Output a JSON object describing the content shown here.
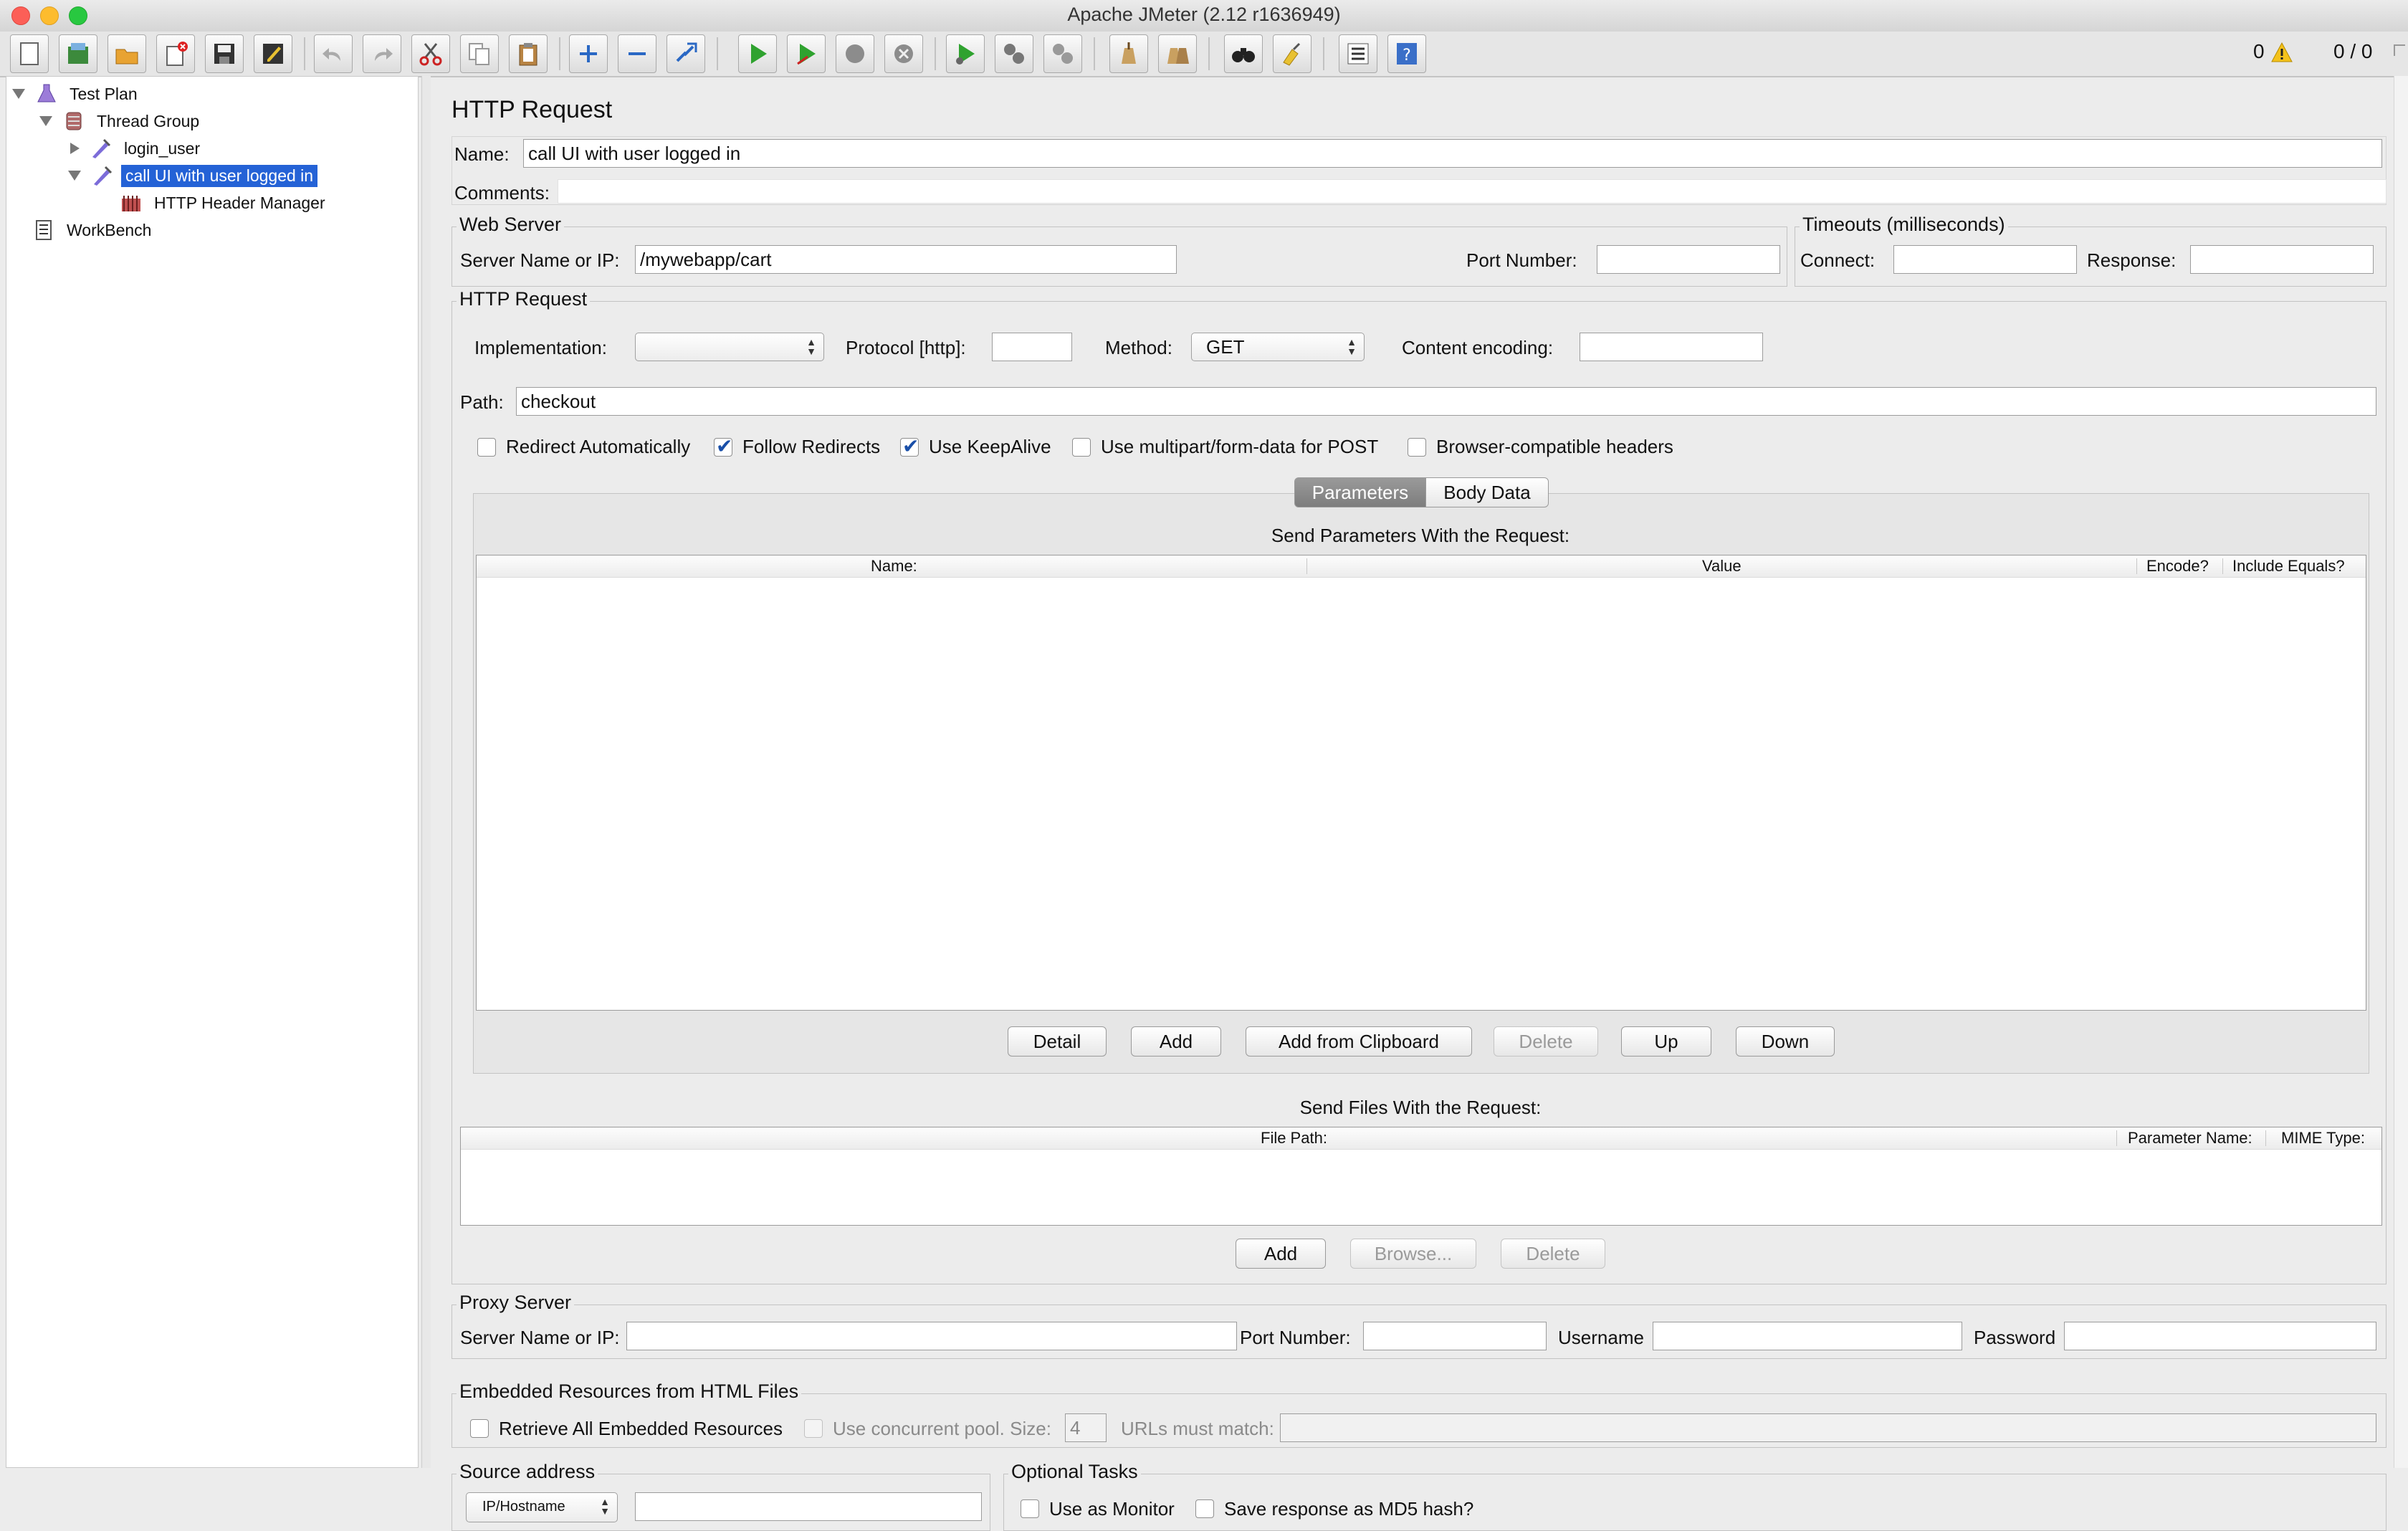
{
  "window": {
    "title": "Apache JMeter (2.12 r1636949)"
  },
  "toolbar": {
    "icons": [
      "new-icon",
      "templates-icon",
      "open-icon",
      "close-icon",
      "save-icon",
      "save-as-icon",
      "undo-icon",
      "redo-icon",
      "cut-icon",
      "copy-icon",
      "paste-icon",
      "expand-icon",
      "collapse-icon",
      "toggle-icon",
      "start-icon",
      "start-no-pauses-icon",
      "stop-icon",
      "shutdown-icon",
      "remote-start-icon",
      "remote-stop-icon",
      "remote-shutdown-icon",
      "clear-icon",
      "clear-all-icon",
      "search-icon",
      "reset-search-icon",
      "function-helper-icon",
      "help-icon"
    ],
    "error_count": "0",
    "threads": "0 / 0"
  },
  "tree": {
    "items": [
      {
        "label": "Test Plan",
        "icon": "test-plan-icon"
      },
      {
        "label": "Thread Group",
        "icon": "thread-group-icon"
      },
      {
        "label": "login_user",
        "icon": "sampler-icon"
      },
      {
        "label": "call UI with user logged in",
        "icon": "sampler-icon",
        "selected": true
      },
      {
        "label": "HTTP Header Manager",
        "icon": "header-manager-icon"
      },
      {
        "label": "WorkBench",
        "icon": "workbench-icon"
      }
    ]
  },
  "panel": {
    "title": "HTTP Request",
    "name_label": "Name:",
    "name_value": "call UI with user logged in",
    "comments_label": "Comments:",
    "web_server": {
      "title": "Web Server",
      "server_label": "Server Name or IP:",
      "server_value": "/mywebapp/cart",
      "port_label": "Port Number:",
      "port_value": ""
    },
    "timeouts": {
      "title": "Timeouts (milliseconds)",
      "connect_label": "Connect:",
      "response_label": "Response:"
    },
    "http_request": {
      "title": "HTTP Request",
      "implementation_label": "Implementation:",
      "implementation_value": "",
      "protocol_label": "Protocol [http]:",
      "method_label": "Method:",
      "method_value": "GET",
      "encoding_label": "Content encoding:",
      "path_label": "Path:",
      "path_value": "checkout",
      "options": [
        {
          "label": "Redirect Automatically",
          "checked": false
        },
        {
          "label": "Follow Redirects",
          "checked": true
        },
        {
          "label": "Use KeepAlive",
          "checked": true
        },
        {
          "label": "Use multipart/form-data for POST",
          "checked": false
        },
        {
          "label": "Browser-compatible headers",
          "checked": false
        }
      ]
    },
    "tabs": {
      "parameters": "Parameters",
      "body_data": "Body Data",
      "active": "parameters"
    },
    "params": {
      "title": "Send Parameters With the Request:",
      "columns": [
        "Name:",
        "Value",
        "Encode?",
        "Include Equals?"
      ],
      "buttons": {
        "detail": "Detail",
        "add": "Add",
        "add_clipboard": "Add from Clipboard",
        "delete": "Delete",
        "up": "Up",
        "down": "Down"
      }
    },
    "files": {
      "title": "Send Files With the Request:",
      "columns": [
        "File Path:",
        "Parameter Name:",
        "MIME Type:"
      ],
      "buttons": {
        "add": "Add",
        "browse": "Browse...",
        "delete": "Delete"
      }
    },
    "proxy": {
      "title": "Proxy Server",
      "server_label": "Server Name or IP:",
      "port_label": "Port Number:",
      "username_label": "Username",
      "password_label": "Password"
    },
    "embedded": {
      "title": "Embedded Resources from HTML Files",
      "retrieve_label": "Retrieve All Embedded Resources",
      "pool_label": "Use concurrent pool. Size:",
      "pool_size": "4",
      "match_label": "URLs must match:"
    },
    "source": {
      "title": "Source address",
      "type_value": "IP/Hostname"
    },
    "optional": {
      "title": "Optional Tasks",
      "monitor_label": "Use as Monitor",
      "md5_label": "Save response as MD5 hash?"
    }
  }
}
